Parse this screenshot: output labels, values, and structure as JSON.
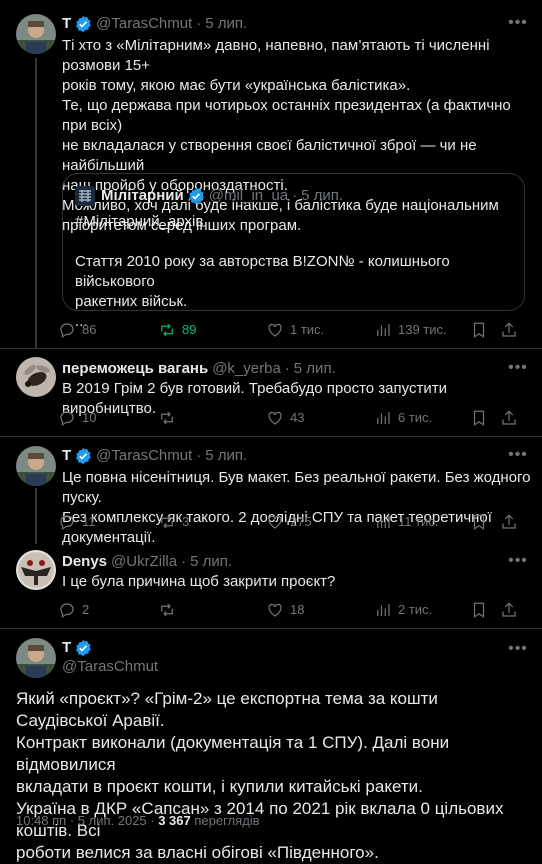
{
  "tweet1": {
    "name": "T",
    "handle": "@TarasChmut",
    "sep": "·",
    "time": "5 лип.",
    "lines": [
      "Ті хто з «Мілітарним» давно, напевно, пам’ятають ті численні розмови 15+",
      "років тому, якою має бути «українська балістика».",
      "Те, що держава при чотирьох останніх президентах (а фактично при всіх)",
      "не вкладалася у створення своєї балістичної зброї — чи не найбільший",
      "наш пройоб у обороноздатності.",
      "Можливо, хоч далі буде інакше, і балістика буде національним",
      "пріоритетом серед інших програм."
    ],
    "quote": {
      "name": "Мілітарний",
      "handle": "@mil_in_ua",
      "sep": "·",
      "time": "5 лип.",
      "lines": [
        "#Мілітарний_архів",
        "",
        "Стаття 2010 року за авторства B!ZON№ - колишнього військового",
        "ракетних військ.",
        "..."
      ]
    },
    "replies": "86",
    "reposts": "89",
    "likes": "1 тис.",
    "views": "139 тис."
  },
  "tweet2": {
    "name": "переможець вагань",
    "handle": "@k_yerba",
    "sep": "·",
    "time": "5 лип.",
    "text": "В 2019 Грім 2 був готовий.  Требабудо просто запустити виробництво.",
    "replies": "10",
    "reposts": "",
    "likes": "43",
    "views": "6 тис."
  },
  "tweet3": {
    "name": "T",
    "handle": "@TarasChmut",
    "sep": "·",
    "time": "5 лип.",
    "lines": [
      "Це повна нісенітниця. Був макет. Без реальної ракети. Без жодного пуску.",
      "Без комплексу як такого. 2 дослідні СПУ та пакет теоретичної документації."
    ],
    "replies": "11",
    "reposts": "3",
    "likes": "275",
    "views": "11 тис."
  },
  "tweet4": {
    "name": "Denys",
    "handle": "@UkrZilla",
    "sep": "·",
    "time": "5 лип.",
    "text": "І це була причина щоб закрити проєкт?",
    "replies": "2",
    "reposts": "",
    "likes": "18",
    "views": "2 тис."
  },
  "main": {
    "name": "T",
    "handle": "@TarasChmut",
    "lines": [
      "Який «проєкт»? «Грім-2» це експортна тема за кошти Саудівської Аравії.",
      "Контракт виконали (документація та 1 СПУ). Далі вони відмовилися",
      "вкладати в проєкт кошти, і купили китайські ракети.",
      "Україна в ДКР «Сапсан» з 2014 по 2021 рік вклала 0 цільових коштів. Всі",
      "роботи велися за власні обігові «Південного»."
    ],
    "timestamp": "10:48 пп · 5 лип. 2025 ·",
    "views_count": "3 367",
    "views_label": "переглядів"
  },
  "colors": {
    "background": "#000000",
    "text": "#e7e9ea",
    "muted": "#71767b",
    "verified": "#1d9bf0",
    "repost_active": "#00ba7c",
    "border": "#2f3336"
  },
  "icons": {
    "reply": "reply-icon",
    "repost": "repost-icon",
    "like": "heart-icon",
    "views": "views-icon",
    "bookmark": "bookmark-icon",
    "share": "share-icon",
    "more": "more-icon",
    "verified": "verified-badge-icon"
  }
}
